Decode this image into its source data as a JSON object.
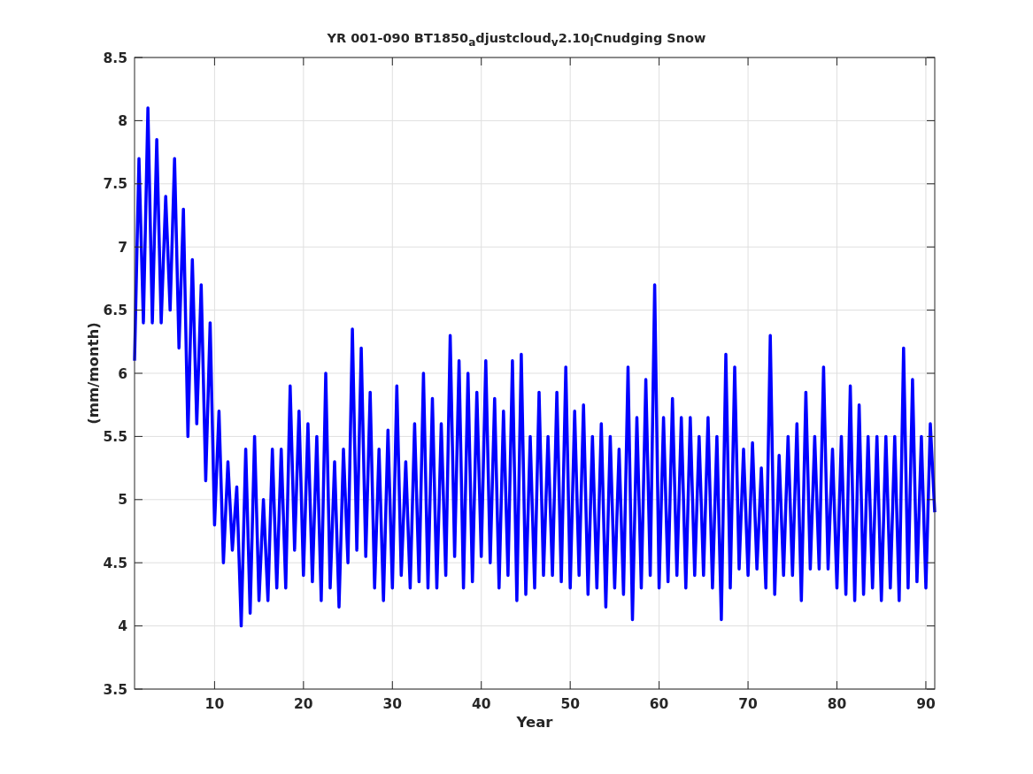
{
  "figure": {
    "chart_data": {
      "type": "line",
      "grid": true,
      "title": "YR 001-090 BT1850$_{a}$djustcloud$_{v}$2.10$_{l}$Cnudging Snow",
      "xlabel": "Year",
      "ylabel": "(mm/month)",
      "xlim": [
        1,
        91
      ],
      "ylim": [
        3.5,
        8.5
      ],
      "xticks": [
        10,
        20,
        30,
        40,
        50,
        60,
        70,
        80,
        90
      ],
      "yticks": [
        3.5,
        4,
        4.5,
        5,
        5.5,
        6,
        6.5,
        7,
        7.5,
        8,
        8.5
      ],
      "x": [
        1,
        1.5,
        2,
        2.5,
        3,
        3.5,
        4,
        4.5,
        5,
        5.5,
        6,
        6.5,
        7,
        7.5,
        8,
        8.5,
        9,
        9.5,
        10,
        10.5,
        11,
        11.5,
        12,
        12.5,
        13,
        13.5,
        14,
        14.5,
        15,
        15.5,
        16,
        16.5,
        17,
        17.5,
        18,
        18.5,
        19,
        19.5,
        20,
        20.5,
        21,
        21.5,
        22,
        22.5,
        23,
        23.5,
        24,
        24.5,
        25,
        25.5,
        26,
        26.5,
        27,
        27.5,
        28,
        28.5,
        29,
        29.5,
        30,
        30.5,
        31,
        31.5,
        32,
        32.5,
        33,
        33.5,
        34,
        34.5,
        35,
        35.5,
        36,
        36.5,
        37,
        37.5,
        38,
        38.5,
        39,
        39.5,
        40,
        40.5,
        41,
        41.5,
        42,
        42.5,
        43,
        43.5,
        44,
        44.5,
        45,
        45.5,
        46,
        46.5,
        47,
        47.5,
        48,
        48.5,
        49,
        49.5,
        50,
        50.5,
        51,
        51.5,
        52,
        52.5,
        53,
        53.5,
        54,
        54.5,
        55,
        55.5,
        56,
        56.5,
        57,
        57.5,
        58,
        58.5,
        59,
        59.5,
        60,
        60.5,
        61,
        61.5,
        62,
        62.5,
        63,
        63.5,
        64,
        64.5,
        65,
        65.5,
        66,
        66.5,
        67,
        67.5,
        68,
        68.5,
        69,
        69.5,
        70,
        70.5,
        71,
        71.5,
        72,
        72.5,
        73,
        73.5,
        74,
        74.5,
        75,
        75.5,
        76,
        76.5,
        77,
        77.5,
        78,
        78.5,
        79,
        79.5,
        80,
        80.5,
        81,
        81.5,
        82,
        82.5,
        83,
        83.5,
        84,
        84.5,
        85,
        85.5,
        86,
        86.5,
        87,
        87.5,
        88,
        88.5,
        89,
        89.5,
        90,
        90.5,
        91
      ],
      "series": [
        {
          "color": "#0000ff",
          "values": [
            6.1,
            7.7,
            6.4,
            8.1,
            6.4,
            7.85,
            6.4,
            7.4,
            6.5,
            7.7,
            6.2,
            7.3,
            5.5,
            6.9,
            5.6,
            6.7,
            5.15,
            6.4,
            4.8,
            5.7,
            4.5,
            5.3,
            4.6,
            5.1,
            4.0,
            5.4,
            4.1,
            5.5,
            4.2,
            5.0,
            4.2,
            5.4,
            4.3,
            5.4,
            4.3,
            5.9,
            4.6,
            5.7,
            4.4,
            5.6,
            4.35,
            5.5,
            4.2,
            6.0,
            4.3,
            5.3,
            4.15,
            5.4,
            4.5,
            6.35,
            4.6,
            6.2,
            4.55,
            5.85,
            4.3,
            5.4,
            4.2,
            5.55,
            4.3,
            5.9,
            4.4,
            5.3,
            4.3,
            5.6,
            4.35,
            6.0,
            4.3,
            5.8,
            4.3,
            5.6,
            4.4,
            6.3,
            4.55,
            6.1,
            4.3,
            6.0,
            4.35,
            5.85,
            4.55,
            6.1,
            4.5,
            5.8,
            4.3,
            5.7,
            4.4,
            6.1,
            4.2,
            6.15,
            4.25,
            5.5,
            4.3,
            5.85,
            4.4,
            5.5,
            4.4,
            5.85,
            4.35,
            6.05,
            4.3,
            5.7,
            4.4,
            5.75,
            4.25,
            5.5,
            4.3,
            5.6,
            4.15,
            5.5,
            4.3,
            5.4,
            4.25,
            6.05,
            4.05,
            5.65,
            4.3,
            5.95,
            4.4,
            6.7,
            4.3,
            5.65,
            4.35,
            5.8,
            4.4,
            5.65,
            4.3,
            5.65,
            4.4,
            5.5,
            4.4,
            5.65,
            4.3,
            5.5,
            4.05,
            6.15,
            4.3,
            6.05,
            4.45,
            5.4,
            4.4,
            5.45,
            4.45,
            5.25,
            4.3,
            6.3,
            4.25,
            5.35,
            4.4,
            5.5,
            4.4,
            5.6,
            4.2,
            5.85,
            4.45,
            5.5,
            4.45,
            6.05,
            4.45,
            5.4,
            4.3,
            5.5,
            4.25,
            5.9,
            4.2,
            5.75,
            4.25,
            5.5,
            4.3,
            5.5,
            4.2,
            5.5,
            4.3,
            5.5,
            4.2,
            6.2,
            4.3,
            5.95,
            4.35,
            5.5,
            4.3,
            5.6,
            4.9
          ]
        }
      ]
    }
  }
}
